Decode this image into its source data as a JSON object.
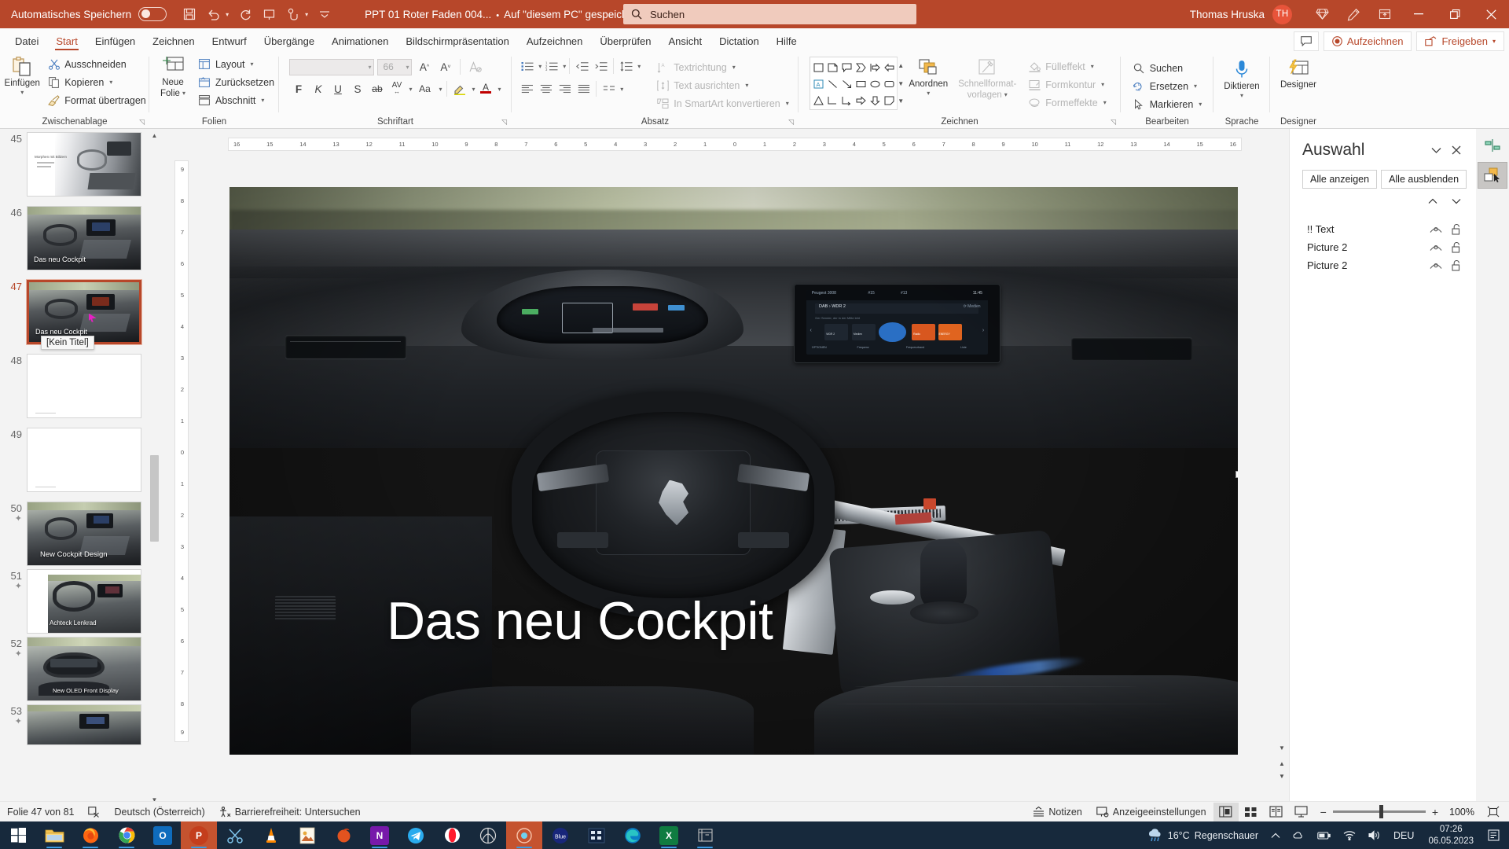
{
  "titlebar": {
    "autosave_label": "Automatisches Speichern",
    "autosave_state": "off",
    "quick_access": [
      "save-icon",
      "undo-icon",
      "redo-icon",
      "start-presentation-icon",
      "touch-mode-icon",
      "customize-qat-icon"
    ],
    "document_title": "PPT 01 Roter Faden 004...",
    "save_location": "Auf \"diesem PC\" gespeichert",
    "user_name": "Thomas Hruska",
    "user_initials": "TH",
    "window_buttons": [
      "minimize",
      "restore",
      "close"
    ]
  },
  "search": {
    "placeholder": "Suchen"
  },
  "tabs": [
    {
      "label": "Datei",
      "active": false
    },
    {
      "label": "Start",
      "active": true
    },
    {
      "label": "Einfügen",
      "active": false
    },
    {
      "label": "Zeichnen",
      "active": false
    },
    {
      "label": "Entwurf",
      "active": false
    },
    {
      "label": "Übergänge",
      "active": false
    },
    {
      "label": "Animationen",
      "active": false
    },
    {
      "label": "Bildschirmpräsentation",
      "active": false
    },
    {
      "label": "Aufzeichnen",
      "active": false
    },
    {
      "label": "Überprüfen",
      "active": false
    },
    {
      "label": "Ansicht",
      "active": false
    },
    {
      "label": "Dictation",
      "active": false
    },
    {
      "label": "Hilfe",
      "active": false
    }
  ],
  "tabbar_right": {
    "comments_label": "",
    "record_label": "Aufzeichnen",
    "share_label": "Freigeben"
  },
  "ribbon": {
    "clipboard": {
      "group_label": "Zwischenablage",
      "paste_label": "Einfügen",
      "cut_label": "Ausschneiden",
      "copy_label": "Kopieren",
      "format_painter_label": "Format übertragen"
    },
    "slides": {
      "group_label": "Folien",
      "new_slide_label_1": "Neue",
      "new_slide_label_2": "Folie",
      "layout_label": "Layout",
      "reset_label": "Zurücksetzen",
      "section_label": "Abschnitt"
    },
    "font": {
      "group_label": "Schriftart",
      "font_face_value": "",
      "font_size_value": "66",
      "bold": "F",
      "italic": "K",
      "underline": "U",
      "shadow": "S",
      "strikethrough": "ab",
      "char_spacing": "AV",
      "change_case": "Aa"
    },
    "paragraph": {
      "group_label": "Absatz",
      "text_direction_label": "Textrichtung",
      "align_text_label": "Text ausrichten",
      "smartart_label": "In SmartArt konvertieren"
    },
    "drawing": {
      "group_label": "Zeichnen",
      "arrange_label": "Anordnen",
      "quick_styles_label_1": "Schnellformat-",
      "quick_styles_label_2": "vorlagen",
      "shape_fill_label": "Fülleffekt",
      "shape_outline_label": "Formkontur",
      "shape_effects_label": "Formeffekte"
    },
    "editing": {
      "group_label": "Bearbeiten",
      "find_label": "Suchen",
      "replace_label": "Ersetzen",
      "select_label": "Markieren"
    },
    "voice": {
      "group_label": "Sprache",
      "dictate_label": "Diktieren"
    },
    "designer": {
      "group_label": "Designer",
      "designer_label": "Designer"
    }
  },
  "thumbnails": [
    {
      "number": "45",
      "caption": "Morphen mit Bildern",
      "kind": "light-photo",
      "starred": false,
      "selected": false
    },
    {
      "number": "46",
      "caption": "Das neu Cockpit",
      "kind": "cockpit",
      "starred": false,
      "selected": false
    },
    {
      "number": "47",
      "caption": "Das neu Cockpit",
      "kind": "cockpit",
      "starred": false,
      "selected": true
    },
    {
      "number": "48",
      "caption": "",
      "kind": "blank",
      "starred": false,
      "selected": false
    },
    {
      "number": "49",
      "caption": "",
      "kind": "blank",
      "starred": false,
      "selected": false
    },
    {
      "number": "50",
      "caption": "New Cockpit Design",
      "kind": "cockpit",
      "starred": true,
      "selected": false
    },
    {
      "number": "51",
      "caption": "Achteck Lenkrad",
      "kind": "wheel",
      "starred": true,
      "selected": false
    },
    {
      "number": "52",
      "caption": "New OLED Front Display",
      "kind": "oled",
      "starred": true,
      "selected": false
    },
    {
      "number": "53",
      "caption": "",
      "kind": "cockpit",
      "starred": true,
      "selected": false
    }
  ],
  "thumbnail_tooltip": "[Kein Titel]",
  "ruler": {
    "horizontal_ticks": [
      "16",
      "15",
      "14",
      "13",
      "12",
      "11",
      "10",
      "9",
      "8",
      "7",
      "6",
      "5",
      "4",
      "3",
      "2",
      "1",
      "0",
      "1",
      "2",
      "3",
      "4",
      "5",
      "6",
      "7",
      "8",
      "9",
      "10",
      "11",
      "12",
      "13",
      "14",
      "15",
      "16"
    ],
    "vertical_ticks": [
      "9",
      "8",
      "7",
      "6",
      "5",
      "4",
      "3",
      "2",
      "1",
      "0",
      "1",
      "2",
      "3",
      "4",
      "5",
      "6",
      "7",
      "8",
      "9"
    ]
  },
  "slide": {
    "title_text": "Das neu Cockpit"
  },
  "selection_pane": {
    "title": "Auswahl",
    "show_all_label": "Alle anzeigen",
    "hide_all_label": "Alle ausblenden",
    "items": [
      {
        "name": "!! Text",
        "visible": true,
        "locked": false
      },
      {
        "name": "Picture 2",
        "visible": true,
        "locked": false
      },
      {
        "name": "Picture 2",
        "visible": true,
        "locked": false
      }
    ]
  },
  "statusbar": {
    "slide_indicator": "Folie 47 von 81",
    "language": "Deutsch (Österreich)",
    "accessibility": "Barrierefreiheit: Untersuchen",
    "notes_label": "Notizen",
    "display_settings_label": "Anzeigeeinstellungen",
    "zoom_percent": "100%",
    "views": [
      "normal-view",
      "slide-sorter-view",
      "reading-view",
      "slideshow-view"
    ]
  },
  "taskbar": {
    "apps": [
      {
        "name": "start-button",
        "glyph": "⊞",
        "color": "#ffffff",
        "bg": "transparent",
        "running": false
      },
      {
        "name": "file-explorer",
        "glyph": "",
        "color": "#ffce5a",
        "bg": "transparent",
        "running": true
      },
      {
        "name": "firefox",
        "glyph": "",
        "color": "#e66000",
        "bg": "transparent",
        "running": true
      },
      {
        "name": "google-chrome",
        "glyph": "",
        "color": "#4285f4",
        "bg": "transparent",
        "running": true
      },
      {
        "name": "outlook",
        "glyph": "O",
        "color": "#ffffff",
        "bg": "#0f6cbd",
        "running": false
      },
      {
        "name": "powerpoint",
        "glyph": "P",
        "color": "#ffffff",
        "bg": "#c43e1c",
        "running": true
      },
      {
        "name": "snipping-tool",
        "glyph": "",
        "color": "#3b9ae1",
        "bg": "transparent",
        "running": false
      },
      {
        "name": "vlc-media-player",
        "glyph": "",
        "color": "#ff8800",
        "bg": "transparent",
        "running": false
      },
      {
        "name": "image-viewer",
        "glyph": "",
        "color": "#e8b64c",
        "bg": "#fdf6e3",
        "running": false
      },
      {
        "name": "handbrake",
        "glyph": "",
        "color": "#e8541f",
        "bg": "transparent",
        "running": false
      },
      {
        "name": "onenote",
        "glyph": "N",
        "color": "#ffffff",
        "bg": "#7719aa",
        "running": true
      },
      {
        "name": "telegram",
        "glyph": "",
        "color": "#2aabee",
        "bg": "transparent",
        "running": false
      },
      {
        "name": "opera",
        "glyph": "",
        "color": "#ff1b2d",
        "bg": "#ffffff",
        "running": false
      },
      {
        "name": "media-app",
        "glyph": "",
        "color": "#dddddd",
        "bg": "transparent",
        "running": false
      },
      {
        "name": "audio-app",
        "glyph": "",
        "color": "#53c7e8",
        "bg": "#c5532f",
        "running": true
      },
      {
        "name": "blue-app",
        "glyph": "",
        "color": "#ffffff",
        "bg": "#18267a",
        "running": false
      },
      {
        "name": "camera-app",
        "glyph": "",
        "color": "#ffffff",
        "bg": "#10233f",
        "running": false
      },
      {
        "name": "microsoft-edge",
        "glyph": "",
        "color": "#0b7ec4",
        "bg": "transparent",
        "running": false
      },
      {
        "name": "excel",
        "glyph": "X",
        "color": "#ffffff",
        "bg": "#107c41",
        "running": true
      },
      {
        "name": "archive-app",
        "glyph": "",
        "color": "#c8c8c8",
        "bg": "transparent",
        "running": true
      }
    ],
    "weather_temp": "16°C",
    "weather_desc": "Regenschauer",
    "keyboard_lang": "DEU",
    "time": "07:26",
    "date": "06.05.2023"
  }
}
